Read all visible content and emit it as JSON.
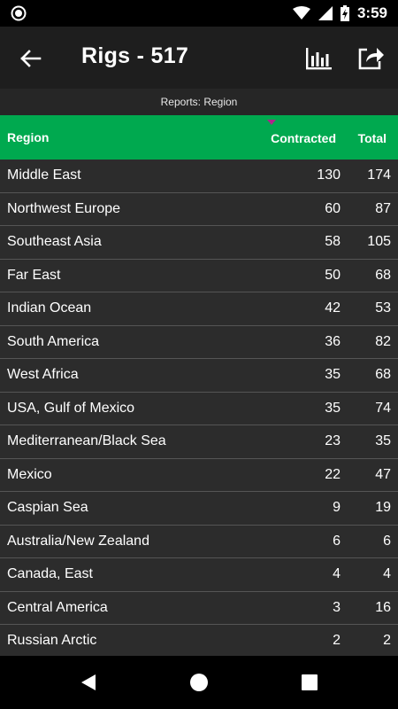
{
  "status_bar": {
    "time": "3:59",
    "icons": [
      "app-indicator-icon",
      "wifi-icon",
      "signal-icon",
      "battery-charging-icon"
    ]
  },
  "app_bar": {
    "title": "Rigs - 517",
    "back_icon": "back-arrow-icon",
    "chart_icon": "bar-chart-icon",
    "share_icon": "share-icon"
  },
  "subheader": {
    "text": "Reports: Region"
  },
  "table": {
    "columns": {
      "region": "Region",
      "contracted": "Contracted",
      "total": "Total"
    },
    "sort_color": "#b0248c",
    "rows": [
      {
        "region": "Middle East",
        "contracted": "130",
        "total": "174"
      },
      {
        "region": "Northwest Europe",
        "contracted": "60",
        "total": "87"
      },
      {
        "region": "Southeast Asia",
        "contracted": "58",
        "total": "105"
      },
      {
        "region": "Far East",
        "contracted": "50",
        "total": "68"
      },
      {
        "region": "Indian Ocean",
        "contracted": "42",
        "total": "53"
      },
      {
        "region": "South America",
        "contracted": "36",
        "total": "82"
      },
      {
        "region": "West Africa",
        "contracted": "35",
        "total": "68"
      },
      {
        "region": "USA, Gulf of Mexico",
        "contracted": "35",
        "total": "74"
      },
      {
        "region": "Mediterranean/Black Sea",
        "contracted": "23",
        "total": "35"
      },
      {
        "region": "Mexico",
        "contracted": "22",
        "total": "47"
      },
      {
        "region": "Caspian Sea",
        "contracted": "9",
        "total": "19"
      },
      {
        "region": "Australia/New Zealand",
        "contracted": "6",
        "total": "6"
      },
      {
        "region": "Canada, East",
        "contracted": "4",
        "total": "4"
      },
      {
        "region": "Central America",
        "contracted": "3",
        "total": "16"
      },
      {
        "region": "Russian Arctic",
        "contracted": "2",
        "total": "2"
      }
    ]
  },
  "nav_bar": {
    "icons": [
      "nav-back-icon",
      "nav-home-icon",
      "nav-recent-apps-icon"
    ]
  },
  "colors": {
    "header_green": "#00a94f",
    "app_bar": "#1e1e1e",
    "row_bg": "#2c2c2c"
  }
}
